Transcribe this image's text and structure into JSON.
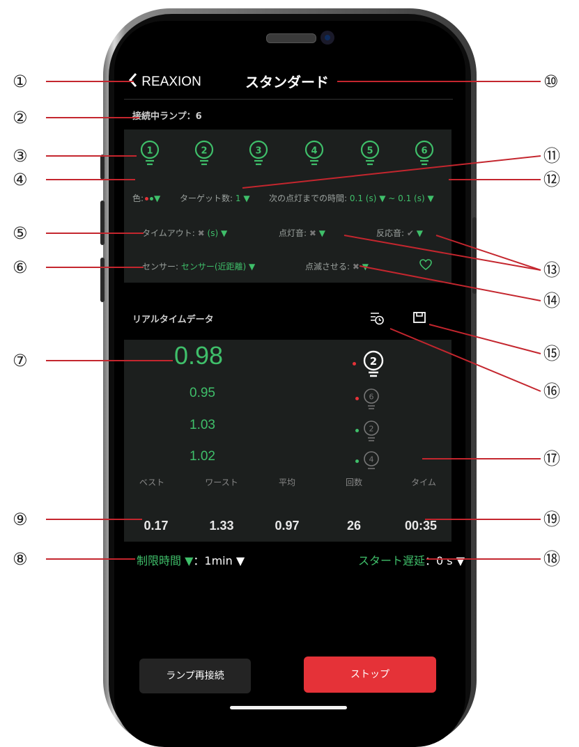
{
  "header": {
    "back_label": "REAXION",
    "title": "スタンダード"
  },
  "connected": {
    "label": "接続中ランプ：6"
  },
  "lamps": [
    "1",
    "2",
    "3",
    "4",
    "5",
    "6"
  ],
  "options": {
    "color_label": "色:",
    "target_label": "ターゲット数:",
    "target_value": "1 ▼",
    "interval_label": "次の点灯までの時間:",
    "interval_value": "0.1 (s) ▼ ~ 0.1 (s) ▼",
    "timeout_label": "タイムアウト:",
    "timeout_value": "(s) ▼",
    "light_sound_label": "点灯音:",
    "light_sound_arrow": "▼",
    "reaction_sound_label": "反応音:",
    "reaction_sound_arrow": "▼",
    "sensor_label": "センサー:",
    "sensor_value": "センサー(近距離) ▼",
    "blink_label": "点滅させる:",
    "blink_arrow": "▼",
    "color_arrow": "▼"
  },
  "realtime": {
    "title": "リアルタイムデータ",
    "latest": "0.98",
    "latest_lamp": "2",
    "history": [
      {
        "value": "0.95",
        "lamp": "6",
        "dot": "#e53238"
      },
      {
        "value": "1.03",
        "lamp": "2",
        "dot": "#3fbf6a"
      },
      {
        "value": "1.02",
        "lamp": "4",
        "dot": "#3fbf6a"
      }
    ]
  },
  "stats": {
    "headers": [
      "ベスト",
      "ワースト",
      "平均",
      "回数",
      "タイム"
    ],
    "values": [
      "0.17",
      "1.33",
      "0.97",
      "26",
      "00:35"
    ]
  },
  "limit": {
    "label": "制限時間 ▼",
    "value": "：1min ▼"
  },
  "delay": {
    "label": "スタート遅延",
    "value": "：0 s ▼"
  },
  "buttons": {
    "reconnect": "ランプ再接続",
    "stop": "ストップ"
  },
  "callouts": [
    "①",
    "②",
    "③",
    "④",
    "⑤",
    "⑥",
    "⑦",
    "⑧",
    "⑨",
    "⑩",
    "⑪",
    "⑫",
    "⑬",
    "⑭",
    "⑮",
    "⑯",
    "⑰",
    "⑱",
    "⑲"
  ],
  "colors": {
    "accent_green": "#3fbf6a",
    "stop_red": "#e53238",
    "panel": "#1c1f1e"
  }
}
